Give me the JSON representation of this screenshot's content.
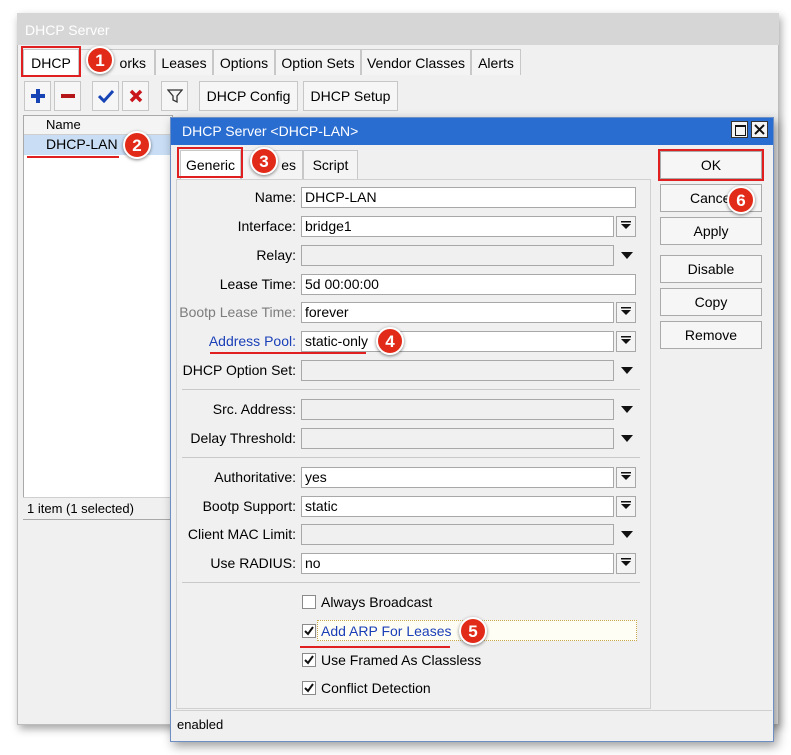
{
  "window": {
    "title": "DHCP Server"
  },
  "tabs": [
    {
      "label": "DHCP"
    },
    {
      "label": "orks"
    },
    {
      "label": "Leases"
    },
    {
      "label": "Options"
    },
    {
      "label": "Option Sets"
    },
    {
      "label": "Vendor Classes"
    },
    {
      "label": "Alerts"
    }
  ],
  "toolbar": {
    "icons": [
      "add-icon",
      "remove-icon",
      "enable-icon",
      "disable-icon",
      "filter-icon"
    ],
    "dhcp_config": "DHCP Config",
    "dhcp_setup": "DHCP Setup"
  },
  "list": {
    "column": "Name",
    "rows": [
      "DHCP-LAN"
    ],
    "status": "1 item (1 selected)"
  },
  "dialog": {
    "title": "DHCP Server <DHCP-LAN>",
    "tabs": [
      "Generic",
      "es",
      "Script"
    ],
    "fields": {
      "name": {
        "label": "Name:",
        "value": "DHCP-LAN"
      },
      "interface": {
        "label": "Interface:",
        "value": "bridge1"
      },
      "relay": {
        "label": "Relay:",
        "value": ""
      },
      "lease_time": {
        "label": "Lease Time:",
        "value": "5d 00:00:00"
      },
      "bootp_lease_time": {
        "label": "Bootp Lease Time:",
        "value": "forever"
      },
      "address_pool": {
        "label": "Address Pool:",
        "value": "static-only"
      },
      "dhcp_option_set": {
        "label": "DHCP Option Set:",
        "value": ""
      },
      "src_address": {
        "label": "Src. Address:",
        "value": ""
      },
      "delay_threshold": {
        "label": "Delay Threshold:",
        "value": ""
      },
      "authoritative": {
        "label": "Authoritative:",
        "value": "yes"
      },
      "bootp_support": {
        "label": "Bootp Support:",
        "value": "static"
      },
      "client_mac_limit": {
        "label": "Client MAC Limit:",
        "value": ""
      },
      "use_radius": {
        "label": "Use RADIUS:",
        "value": "no"
      }
    },
    "checkboxes": {
      "always_broadcast": {
        "label": "Always Broadcast",
        "checked": false
      },
      "add_arp": {
        "label": "Add ARP For Leases",
        "checked": true
      },
      "framed": {
        "label": "Use Framed As Classless",
        "checked": true
      },
      "conflict": {
        "label": "Conflict Detection",
        "checked": true
      }
    },
    "buttons": {
      "ok": "OK",
      "cancel": "Cance",
      "apply": "Apply",
      "disable": "Disable",
      "copy": "Copy",
      "remove": "Remove"
    },
    "status": "enabled"
  },
  "annotations": {
    "step1": "1",
    "step2": "2",
    "step3": "3",
    "step4": "4",
    "step5": "5",
    "step6": "6"
  },
  "colors": {
    "title_bar": "#2a6dd1",
    "highlight": "#e02020",
    "selected_row": "#c9def5",
    "link": "#1a3fb8"
  }
}
